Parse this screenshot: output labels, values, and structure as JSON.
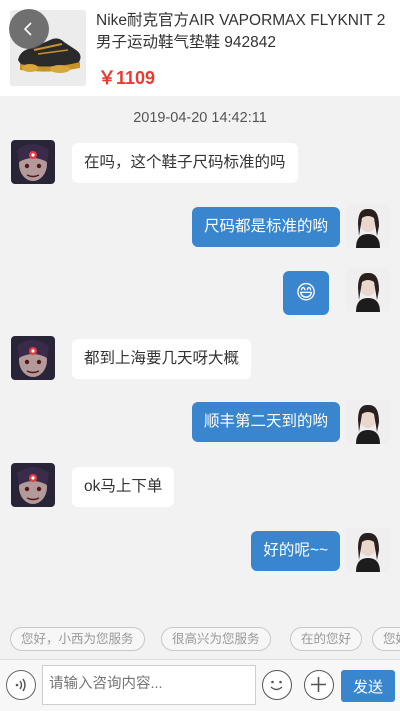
{
  "product": {
    "title": "Nike耐克官方AIR VAPORMAX FLYKNIT 2男子运动鞋气垫鞋 942842",
    "price": "￥1109",
    "image_icon": "shoe-image"
  },
  "chat": {
    "timestamp": "2019-04-20 14:42:11",
    "messages": [
      {
        "side": "left",
        "text": "在吗，这个鞋子尺码标准的吗"
      },
      {
        "side": "right",
        "text": "尺码都是标准的哟"
      },
      {
        "side": "right",
        "text": "😄",
        "is_emoji": true
      },
      {
        "side": "left",
        "text": "都到上海要几天呀大概"
      },
      {
        "side": "right",
        "text": "顺丰第二天到的哟"
      },
      {
        "side": "left",
        "text": "ok马上下单"
      },
      {
        "side": "right",
        "text": "好的呢~~"
      }
    ]
  },
  "quick_replies": [
    "您好，小西为您服务",
    "很高兴为您服务",
    "在的您好",
    "您好"
  ],
  "input": {
    "placeholder": "请输入咨询内容...",
    "send_label": "发送"
  },
  "colors": {
    "accent": "#3a86ce",
    "price": "#e63c32",
    "background": "#f2f2f2"
  }
}
